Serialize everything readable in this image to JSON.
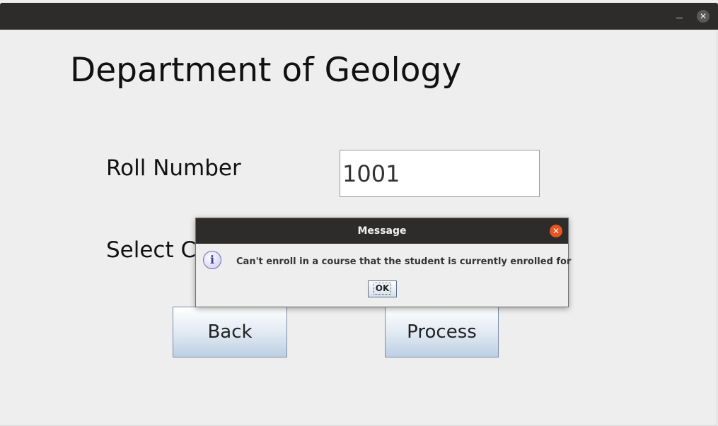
{
  "window": {
    "minimize_icon": "minimize-icon",
    "close_icon": "close-icon",
    "close_glyph": "✕"
  },
  "form": {
    "heading": "Department of Geology",
    "roll_label": "Roll Number",
    "roll_value": "1001",
    "course_label": "Select Course",
    "back_label": "Back",
    "process_label": "Process"
  },
  "dialog": {
    "title": "Message",
    "close_glyph": "✕",
    "icon": "info-icon",
    "icon_glyph": "i",
    "message": "Can't enroll in a course that the student is currently enrolled for",
    "ok_label": "OK"
  }
}
